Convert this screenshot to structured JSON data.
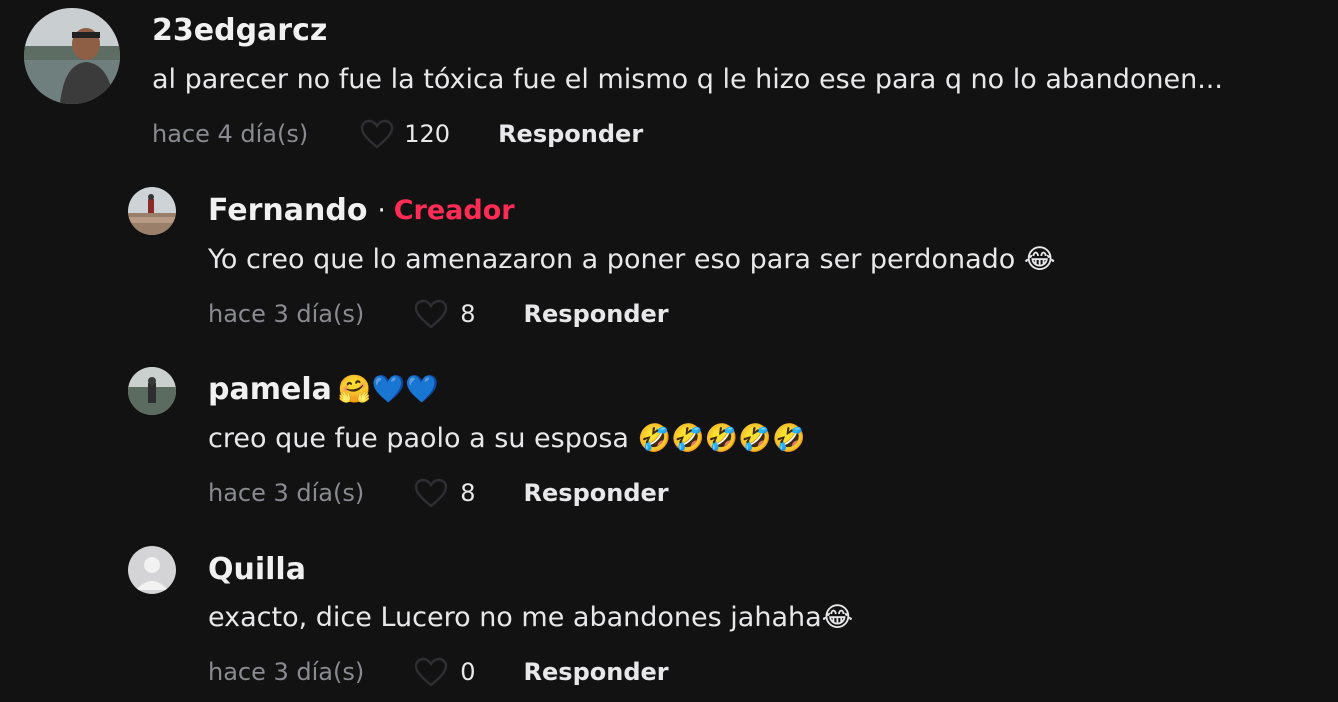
{
  "comments": [
    {
      "username": "23edgarcz",
      "text": "al parecer no fue la tóxica fue el mismo q le hizo ese para q no lo abandonen...",
      "time": "hace 4 día(s)",
      "likes": "120",
      "reply": "Responder",
      "avatar": "lakeside-selfie-avatar"
    }
  ],
  "replies": [
    {
      "username": "Fernando",
      "separator": "·",
      "badge": "Creador",
      "badge_color": "#fe2c55",
      "text": "Yo creo que lo amenazaron a poner eso para ser perdonado 😂",
      "time": "hace 3 día(s)",
      "likes": "8",
      "reply": "Responder",
      "avatar": "landscape-avatar"
    },
    {
      "username": "pamela",
      "username_emoji": "🤗💙💙",
      "text": "creo que fue paolo a su esposa 🤣🤣🤣🤣🤣",
      "time": "hace 3 día(s)",
      "likes": "8",
      "reply": "Responder",
      "avatar": "outdoor-person-avatar"
    },
    {
      "username": "Quilla",
      "text": "exacto, dice Lucero no me abandones jahaha😂",
      "time": "hace 3 día(s)",
      "likes": "0",
      "reply": "Responder",
      "avatar": "default-avatar"
    }
  ],
  "colors": {
    "background": "#121212",
    "username": "#f1f1f2",
    "secondary": "#8a8b91",
    "creator": "#fe2c55"
  }
}
